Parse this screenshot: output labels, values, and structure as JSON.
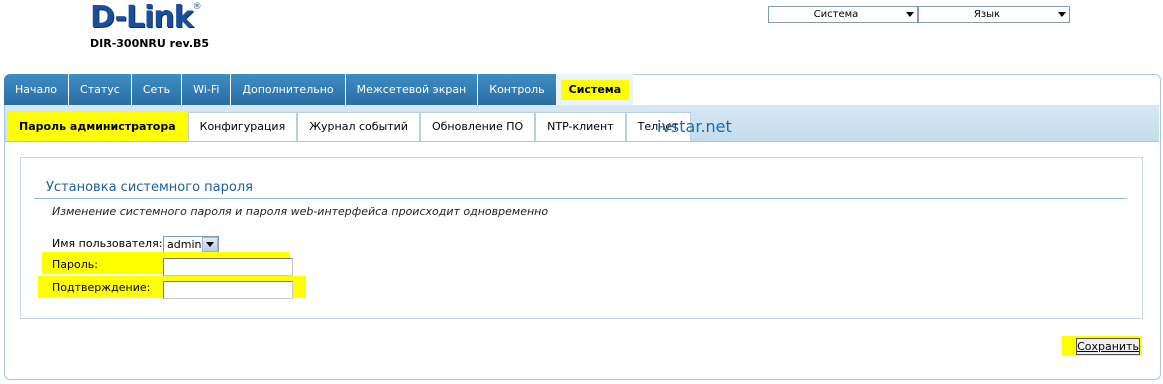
{
  "header": {
    "logo_text": "D-Link",
    "logo_mark": "®",
    "model": "DIR-300NRU rev.B5",
    "system_menu": "Система",
    "language_menu": "Язык"
  },
  "main_tabs": [
    {
      "label": "Начало"
    },
    {
      "label": "Статус"
    },
    {
      "label": "Сеть"
    },
    {
      "label": "Wi-Fi"
    },
    {
      "label": "Дополнительно"
    },
    {
      "label": "Межсетевой экран"
    },
    {
      "label": "Контроль"
    },
    {
      "label": "Система"
    }
  ],
  "sub_tabs": [
    {
      "label": "Пароль администратора"
    },
    {
      "label": "Конфигурация"
    },
    {
      "label": "Журнал событий"
    },
    {
      "label": "Обновление ПО"
    },
    {
      "label": "NTP-клиент"
    },
    {
      "label": "Телнет"
    }
  ],
  "watermark": "ivstar.net",
  "form": {
    "title": "Установка системного пароля",
    "description": "Изменение системного пароля и пароля web-интерфейса происходит одновременно",
    "username_label": "Имя пользователя:",
    "username_value": "admin",
    "password_label": "Пароль:",
    "password_value": "",
    "confirm_label": "Подтверждение:",
    "confirm_value": ""
  },
  "save_label": "Сохранить",
  "colors": {
    "accent": "#2a6ea6",
    "highlight": "#ffff00",
    "title": "#1b5f9c"
  }
}
